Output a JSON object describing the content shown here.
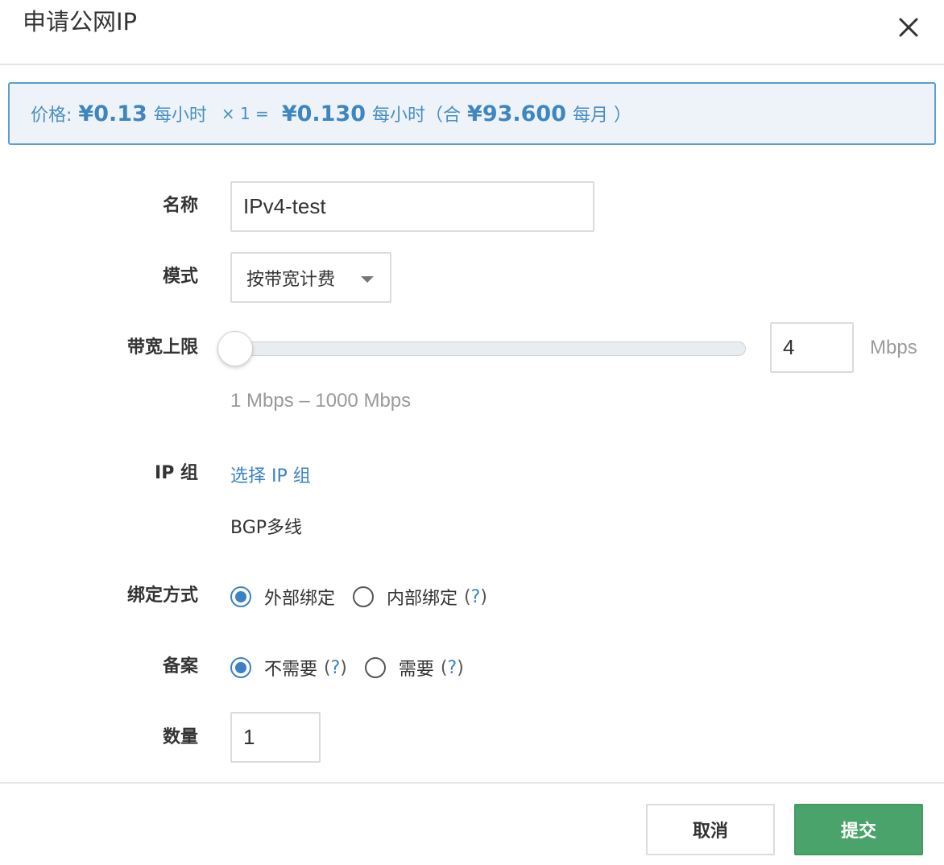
{
  "header": {
    "title": "申请公网IP",
    "close_icon": "close-icon"
  },
  "price": {
    "label": "价格:",
    "unit_price": "¥0.13",
    "per_hour": "每小时",
    "multiplier": "× 1 =",
    "total_hour": "¥0.130",
    "per_hour_2": "每小时（合",
    "total_month": "¥93.600",
    "per_month": "每月 ）",
    "color": "#4a8ec2"
  },
  "form": {
    "name": {
      "label": "名称",
      "value": "IPv4-test"
    },
    "mode": {
      "label": "模式",
      "value": "按带宽计费"
    },
    "bandwidth": {
      "label": "带宽上限",
      "value": "4",
      "unit": "Mbps",
      "range_hint": "1 Mbps – 1000 Mbps",
      "min": 1,
      "max": 1000
    },
    "ip_group": {
      "label": "IP 组",
      "link": "选择 IP 组",
      "current": "BGP多线"
    },
    "binding": {
      "label": "绑定方式",
      "options": [
        {
          "label": "外部绑定",
          "selected": true
        },
        {
          "label": "内部绑定",
          "selected": false,
          "help": "?"
        }
      ]
    },
    "filing": {
      "label": "备案",
      "options": [
        {
          "label": "不需要",
          "selected": true,
          "help": "?"
        },
        {
          "label": "需要",
          "selected": false,
          "help": "?"
        }
      ]
    },
    "quantity": {
      "label": "数量",
      "value": "1"
    }
  },
  "footer": {
    "cancel_label": "取消",
    "submit_label": "提交",
    "submit_color": "#4aa36a"
  }
}
